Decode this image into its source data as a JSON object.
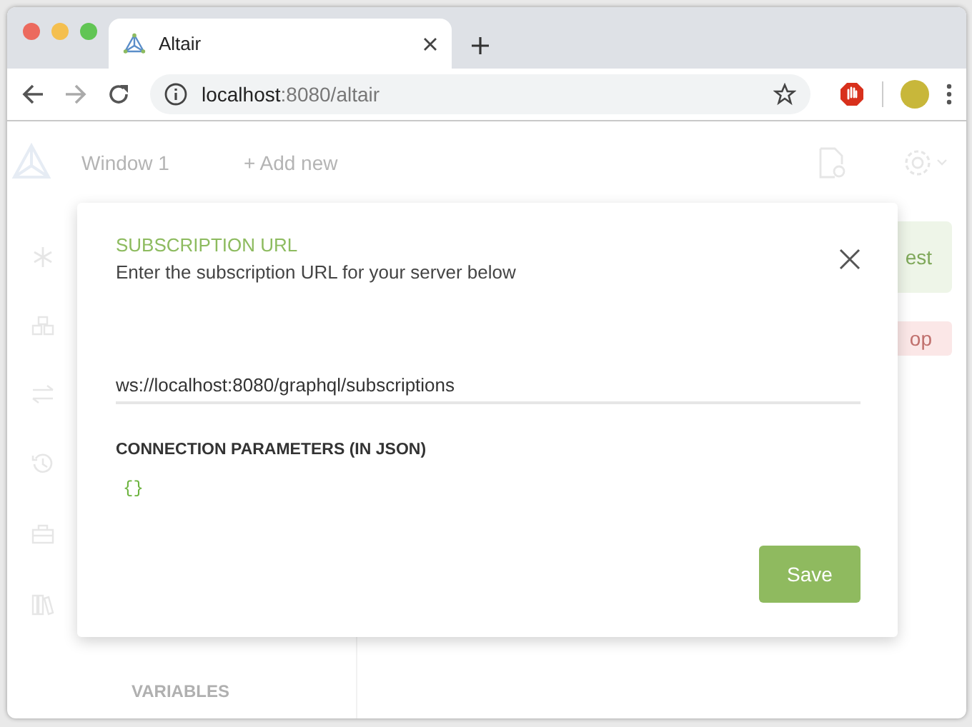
{
  "browser": {
    "tab": {
      "title": "Altair"
    },
    "address": {
      "host": "localhost",
      "path": ":8080/altair"
    }
  },
  "app": {
    "window_tab": "Window 1",
    "add_new": "+ Add new",
    "send_button": "est",
    "stop_button": "op",
    "variables_label": "VARIABLES"
  },
  "dialog": {
    "title": "SUBSCRIPTION URL",
    "description": "Enter the subscription URL for your server below",
    "url_field": {
      "value": "ws://localhost:8080/graphql/subscriptions"
    },
    "params_label": "CONNECTION PARAMETERS (IN JSON)",
    "params_value": "{}",
    "save_button": "Save"
  }
}
